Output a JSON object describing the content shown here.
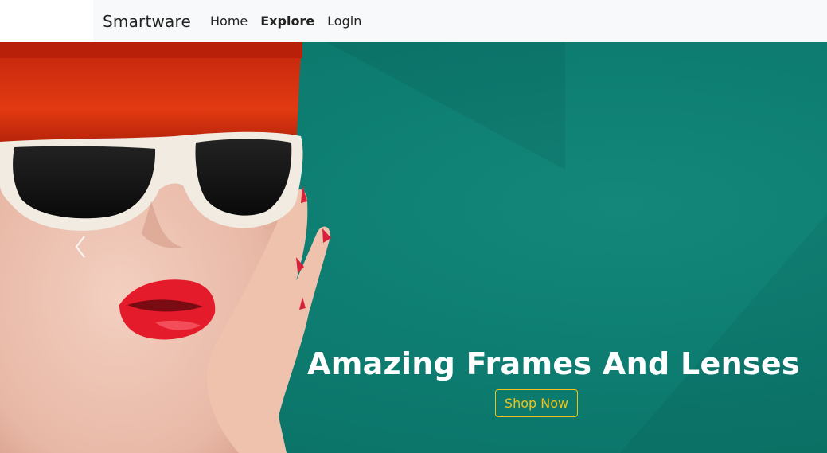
{
  "navbar": {
    "brand": "Smartware",
    "links": [
      {
        "label": "Home",
        "active": false
      },
      {
        "label": "Explore",
        "active": true
      },
      {
        "label": "Login",
        "active": false
      }
    ],
    "background": "#f8f9fa"
  },
  "hero": {
    "headline": "Amazing Frames And Lenses",
    "cta_label": "Shop Now",
    "background": "#0b8073",
    "cta_color": "#f0c419",
    "prev_icon": "chevron-left-icon",
    "image": "woman-with-sunglasses"
  }
}
